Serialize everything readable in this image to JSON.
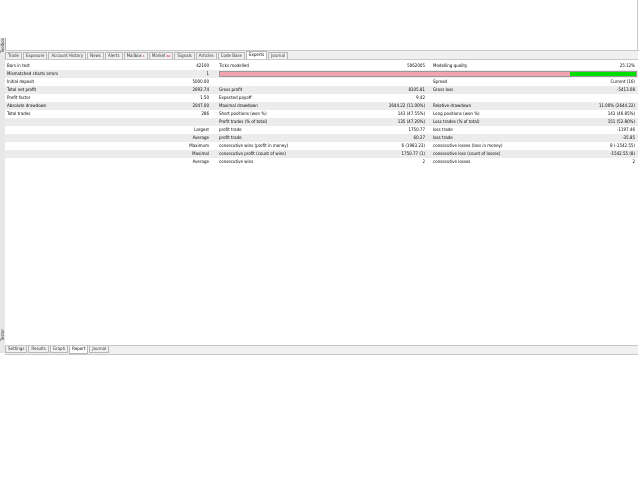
{
  "toolbox": {
    "label": "Toolbox",
    "tabs": [
      {
        "label": "Trade"
      },
      {
        "label": "Exposure"
      },
      {
        "label": "Account History"
      },
      {
        "label": "News"
      },
      {
        "label": "Alerts"
      },
      {
        "label": "Mailbox",
        "badge": "1"
      },
      {
        "label": "Market",
        "badge": "64"
      },
      {
        "label": "Signals"
      },
      {
        "label": "Articles"
      },
      {
        "label": "Code Base"
      },
      {
        "label": "Experts",
        "active": true
      },
      {
        "label": "Journal"
      }
    ]
  },
  "tester": {
    "label": "Tester",
    "tabs": [
      {
        "label": "Settings"
      },
      {
        "label": "Results"
      },
      {
        "label": "Graph"
      },
      {
        "label": "Report",
        "active": true
      },
      {
        "label": "Journal"
      }
    ]
  },
  "report": {
    "r0": {
      "c1l": "Bars in test",
      "c1v": "42100",
      "c2l": "Ticks modelled",
      "c2v": "5062005",
      "c3l": "Modelling quality",
      "c3v": "25.12%"
    },
    "r1": {
      "c1l": "Mismatched charts errors",
      "c1v": "1",
      "quality_bar_value": 0.841
    },
    "r2": {
      "c1l": "Initial deposit",
      "c1v": "5000.00",
      "c3l": "Spread",
      "c3v": "Current (16)"
    },
    "r3": {
      "c1l": "Total net profit",
      "c1v": "2692.74",
      "c2l": "Gross profit",
      "c2v": "8105.81",
      "c3l": "Gross loss",
      "c3v": "-5413.08"
    },
    "r4": {
      "c1l": "Profit factor",
      "c1v": "1.50",
      "c2l": "Expected payoff",
      "c2v": "9.42"
    },
    "r5": {
      "c1l": "Absolute drawdown",
      "c1v": "2047.00",
      "c2l": "Maximal drawdown",
      "c2v": "2644.22 (11.00%)",
      "c3l": "Relative drawdown",
      "c3v": "11.00% (2644.22)"
    },
    "r6": {
      "c1l": "Total trades",
      "c1v": "286",
      "c2l": "Short positions (won %)",
      "c2v": "143 (47.55%)",
      "c3l": "Long positions (won %)",
      "c3v": "143 (46.85%)"
    },
    "r7": {
      "c2l": "Profit trades (% of total)",
      "c2v": "135 (47.20%)",
      "c3l": "Loss trades (% of total)",
      "c3v": "151 (52.80%)"
    },
    "r8": {
      "c1v": "Largest",
      "c2l": "profit trade",
      "c2v": "1750.77",
      "c3l": "loss trade",
      "c3v": "-1197.46"
    },
    "r9": {
      "c1v": "Average",
      "c2l": "profit trade",
      "c2v": "60.27",
      "c3l": "loss trade",
      "c3v": "-35.85"
    },
    "r10": {
      "c1v": "Maximum",
      "c2l": "consecutive wins (profit in money)",
      "c2v": "6 (1983.23)",
      "c3l": "consecutive losses (loss in money)",
      "c3v": "8 (-1542.55)"
    },
    "r11": {
      "c1v": "Maximal",
      "c2l": "consecutive profit (count of wins)",
      "c2v": "1750.77 (1)",
      "c3l": "consecutive loss (count of losses)",
      "c3v": "-1542.55 (8)"
    },
    "r12": {
      "c1v": "Average",
      "c2l": "consecutive wins",
      "c2v": "2",
      "c3l": "consecutive losses",
      "c3v": "2"
    }
  },
  "colors": {
    "bar_pink": "#f2a3ad",
    "bar_green": "#00e000"
  }
}
